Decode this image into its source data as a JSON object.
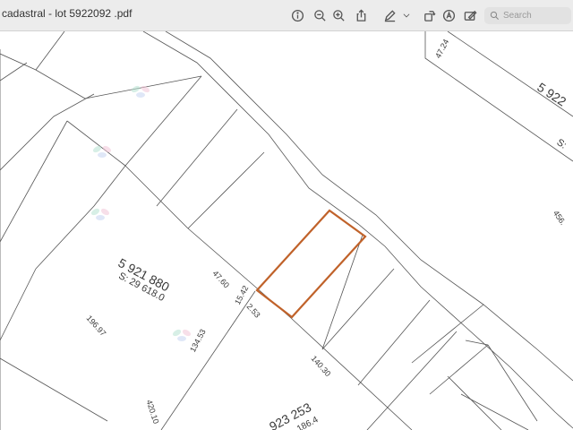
{
  "app": {
    "window_title": "cadastral - lot 5922092 .pdf"
  },
  "toolbar": {
    "icons": [
      "info-icon",
      "zoom-out-icon",
      "zoom-in-icon",
      "share-icon",
      "markup-pen-icon",
      "chevron-down-icon",
      "rotate-icon",
      "highlight-icon",
      "form-fill-icon"
    ],
    "search_placeholder": "Search"
  },
  "map": {
    "lot_main_number": "5 921 880",
    "lot_main_area": "S: 29 618.0",
    "lot_bottom_number": "923 253",
    "lot_bottom_area": "186.4",
    "lot_right_number": "5 922",
    "lot_right_area": "S:",
    "dim_top_right": "47.24",
    "dim_right_edge": "456.",
    "dim_47_60": "47.60",
    "dim_15_42": "15.42",
    "dim_2_53": "2.53",
    "dim_134_53": "134.53",
    "dim_196_97": "196.97",
    "dim_140_30": "140.30",
    "dim_420_10": "420.10",
    "highlight_color": "#c0622a"
  }
}
